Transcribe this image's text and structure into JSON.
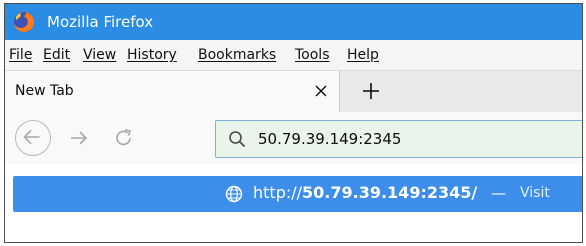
{
  "window": {
    "title": "Mozilla Firefox",
    "titlebar_color": "#2b8ce3"
  },
  "menu": {
    "items": [
      {
        "label": "File",
        "accel": "F"
      },
      {
        "label": "Edit",
        "accel": "E"
      },
      {
        "label": "View",
        "accel": "V"
      },
      {
        "label": "History",
        "accel": "s"
      },
      {
        "label": "Bookmarks",
        "accel": "B"
      },
      {
        "label": "Tools",
        "accel": "T"
      },
      {
        "label": "Help",
        "accel": "H"
      }
    ]
  },
  "tabs": {
    "active": {
      "title": "New Tab",
      "close_icon": "close-icon"
    },
    "new_tab_icon": "plus-icon"
  },
  "navigation": {
    "back_icon": "back-arrow-icon",
    "forward_icon": "forward-arrow-icon",
    "reload_icon": "reload-icon"
  },
  "urlbar": {
    "icon": "search-icon",
    "value": "50.79.39.149:2345"
  },
  "suggestion": {
    "icon": "globe-icon",
    "url_prefix": "http://",
    "url_host": "50.79.39.149:2345/",
    "separator": "—",
    "action": "Visit",
    "highlight_color": "#3d8eea"
  }
}
